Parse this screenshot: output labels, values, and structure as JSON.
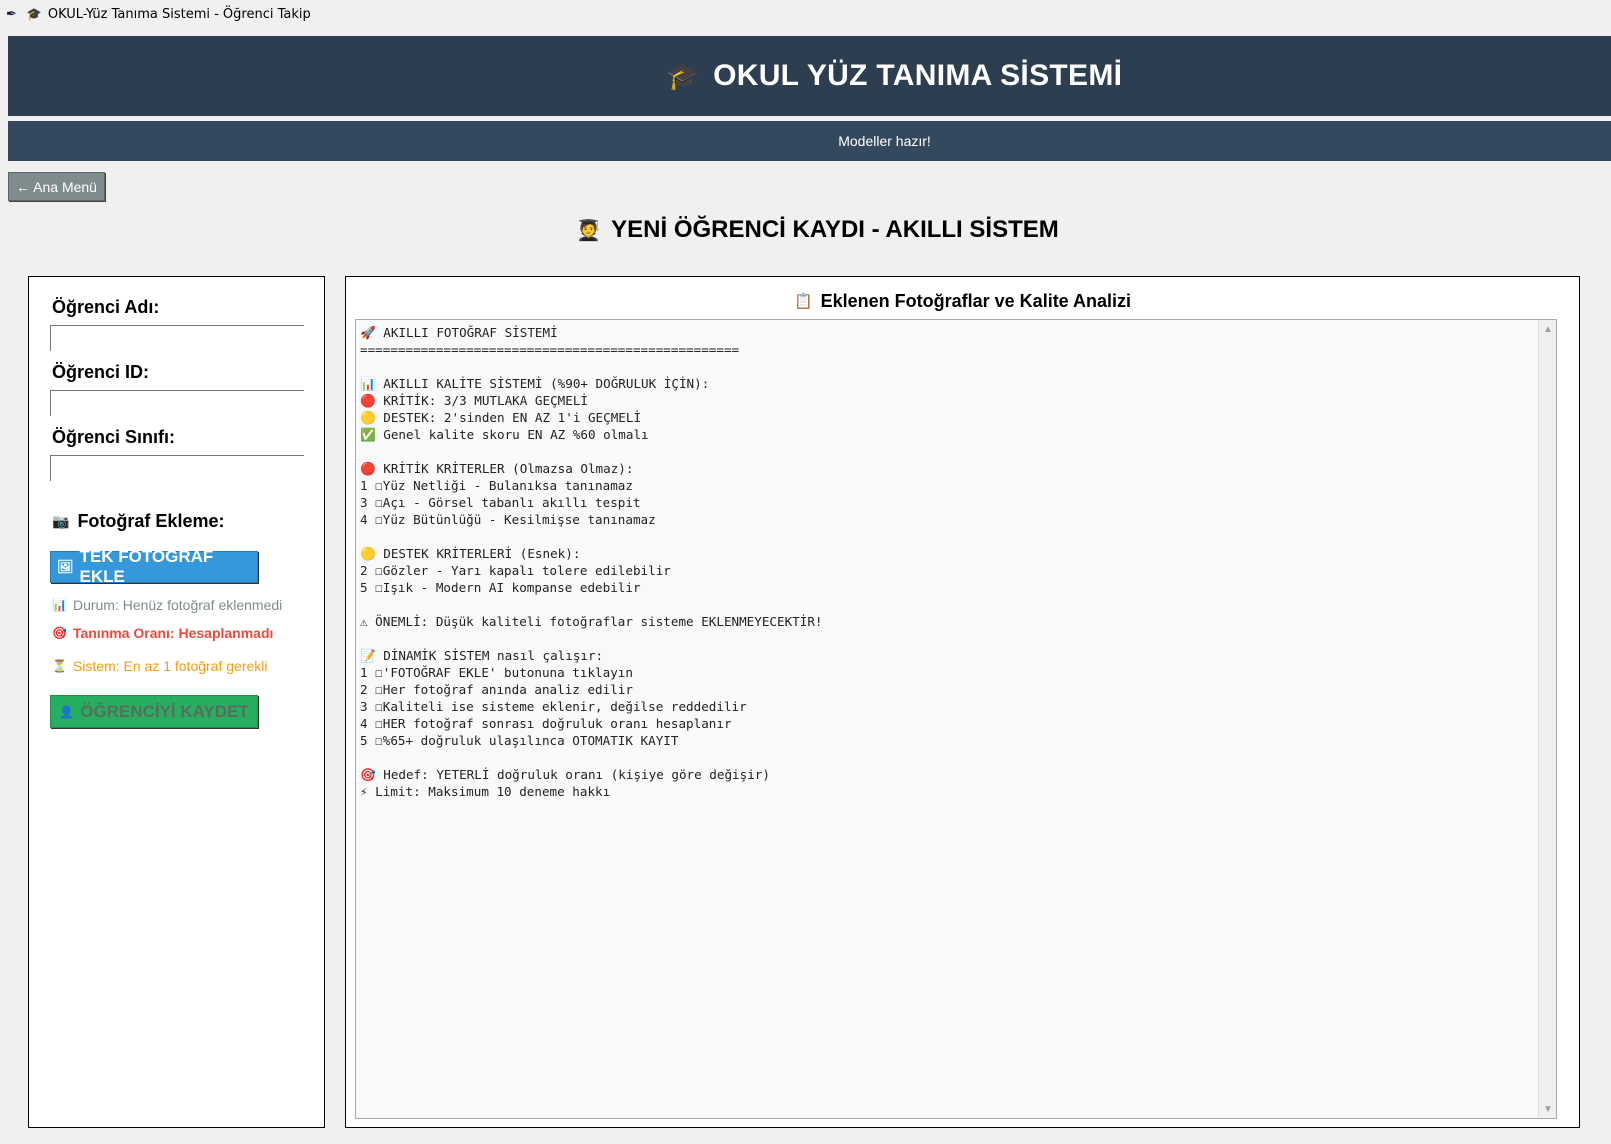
{
  "window": {
    "title": "OKUL-Yüz Tanıma Sistemi - Öğrenci Takip",
    "app_icon": "feather-icon",
    "cap_icon": "🎓"
  },
  "header": {
    "icon": "🎓",
    "title": "OKUL YÜZ TANIMA SİSTEMİ"
  },
  "status": {
    "text": "Modeller hazır!"
  },
  "nav": {
    "back_label": "← Ana Menü"
  },
  "page": {
    "icon": "🧑‍🎓",
    "title": "YENİ ÖĞRENCİ KAYDI - AKILLI SİSTEM"
  },
  "form": {
    "name_label": "Öğrenci Adı:",
    "name_value": "",
    "id_label": "Öğrenci ID:",
    "id_value": "",
    "class_label": "Öğrenci Sınıfı:",
    "class_value": "",
    "photo_section_label": "Fotoğraf Ekleme:",
    "photo_section_icon": "📷",
    "add_photo_label": "TEK FOTOĞRAF EKLE",
    "add_photo_icon": "🖼",
    "status_icon": "📊",
    "status_text": "Durum: Henüz fotoğraf eklenmedi",
    "recognition_icon": "🎯",
    "recognition_text": "Tanınma Oranı: Hesaplanmadı",
    "system_icon": "⏳",
    "system_text": "Sistem: En az 1 fotoğraf gerekli",
    "save_label": "ÖĞRENCİYİ KAYDET",
    "save_icon": "👤"
  },
  "analysis": {
    "title": "Eklenen Fotoğraflar ve Kalite Analizi",
    "title_icon": "📋",
    "lines": [
      "🚀 AKILLI FOTOĞRAF SİSTEMİ",
      "==================================================",
      "",
      "📊 AKILLI KALİTE SİSTEMİ (%90+ DOĞRULUK İÇİN):",
      "🔴 KRİTİK: 3/3 MUTLAKA GEÇMELİ",
      "🟡 DESTEK: 2'sinden EN AZ 1'i GEÇMELİ",
      "✅ Genel kalite skoru EN AZ %60 olmalı",
      "",
      "🔴 KRİTİK KRİTERLER (Olmazsa Olmaz):",
      "1 ☐Yüz Netliği - Bulanıksa tanınamaz",
      "3 ☐Açı - Görsel tabanlı akıllı tespit",
      "4 ☐Yüz Bütünlüğü - Kesilmişse tanınamaz",
      "",
      "🟡 DESTEK KRİTERLERİ (Esnek):",
      "2 ☐Gözler - Yarı kapalı tolere edilebilir",
      "5 ☐Işık - Modern AI kompanse edebilir",
      "",
      "⚠ ÖNEMLİ: Düşük kaliteli fotoğraflar sisteme EKLENMEYECEKTİR!",
      "",
      "📝 DİNAMİK SİSTEM nasıl çalışır:",
      "1 ☐'FOTOĞRAF EKLE' butonuna tıklayın",
      "2 ☐Her fotoğraf anında analiz edilir",
      "3 ☐Kaliteli ise sisteme eklenir, değilse reddedilir",
      "4 ☐HER fotoğraf sonrası doğruluk oranı hesaplanır",
      "5 ☐%65+ doğruluk ulaşılınca OTOMATIK KAYIT",
      "",
      "🎯 Hedef: YETERLİ doğruluk oranı (kişiye göre değişir)",
      "⚡ Limit: Maksimum 10 deneme hakkı"
    ]
  },
  "colors": {
    "header_bg": "#2c3e50",
    "status_bg": "#34495e",
    "back_btn": "#7f8c8d",
    "add_btn": "#3498db",
    "save_btn": "#27ae60",
    "status_gray": "#7f8c8d",
    "status_red": "#e74c3c",
    "status_orange": "#f39c12"
  }
}
